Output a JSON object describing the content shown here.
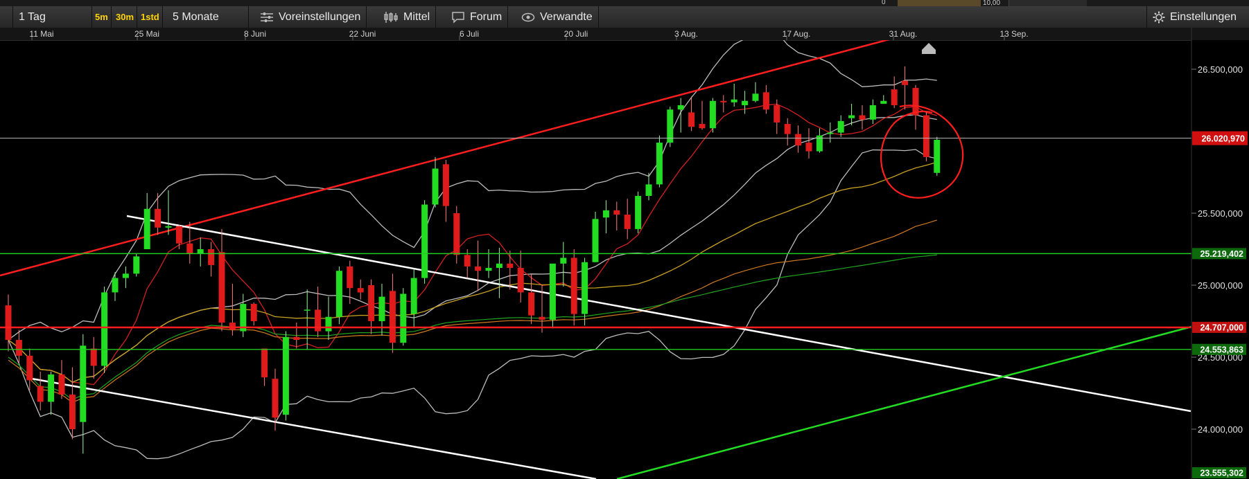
{
  "top_fragments": {
    "left_value": "0",
    "right_value": "10,00"
  },
  "toolbar": {
    "interval": "1 Tag",
    "quick_5m": "5m",
    "quick_30m": "30m",
    "quick_1std": "1std",
    "range": "5 Monate",
    "presets": "Voreinstellungen",
    "chart_style": "Mittel",
    "forum": "Forum",
    "related": "Verwandte",
    "settings": "Einstellungen"
  },
  "colors": {
    "background": "#000000",
    "bull": "#22dd22",
    "bear": "#e01b1b",
    "channel_red": "#ff1e1e",
    "channel_white": "#ffffff",
    "channel_green": "#22dd22",
    "price_label": "#d01010",
    "bollinger": "#bdbdbd"
  },
  "chart_data": {
    "type": "candlestick",
    "x_axis_labels": [
      "11 Mai",
      "25 Mai",
      "8 Juni",
      "22 Juni",
      "6 Juli",
      "20 Juli",
      "3 Aug.",
      "17 Aug.",
      "31 Aug.",
      "13 Sep."
    ],
    "y_tick_labels": [
      "26.500,000",
      "25.500,000",
      "25.000,000",
      "24.500,000",
      "24.000,000"
    ],
    "y_ticks": [
      26500,
      25500,
      25000,
      24500,
      24000
    ],
    "ylim": [
      23540,
      26760
    ],
    "current_price": {
      "value": 26020.97,
      "label": "26.020,970"
    },
    "price_levels": [
      {
        "value": 25219.402,
        "label": "25.219,402",
        "color": "green"
      },
      {
        "value": 24707.0,
        "label": "24.707,000",
        "color": "red"
      },
      {
        "value": 24553.863,
        "label": "24.553,863",
        "color": "green"
      },
      {
        "value": 23555.302,
        "label": "23.555,302",
        "color": "green"
      }
    ],
    "candles": [
      [
        1,
        24860,
        24935,
        24540,
        24620
      ],
      [
        2,
        24620,
        24690,
        24460,
        24510
      ],
      [
        3,
        24510,
        24560,
        24270,
        24340
      ],
      [
        4,
        24300,
        24400,
        24130,
        24190
      ],
      [
        5,
        24190,
        24400,
        24100,
        24380
      ],
      [
        6,
        24380,
        24480,
        24210,
        24240
      ],
      [
        7,
        24240,
        24430,
        23930,
        24000
      ],
      [
        8,
        24050,
        24660,
        23830,
        24580
      ],
      [
        9,
        24560,
        24640,
        24350,
        24440
      ],
      [
        10,
        24440,
        24990,
        24390,
        24950
      ],
      [
        11,
        24950,
        25090,
        24890,
        25050
      ],
      [
        12,
        25050,
        25130,
        24980,
        25080
      ],
      [
        13,
        25080,
        25220,
        25060,
        25200
      ],
      [
        14,
        25250,
        25640,
        25280,
        25530
      ],
      [
        15,
        25530,
        25640,
        25350,
        25400
      ],
      [
        16,
        25400,
        25660,
        25350,
        25410
      ],
      [
        17,
        25410,
        25420,
        25250,
        25290
      ],
      [
        18,
        25290,
        25440,
        25150,
        25220
      ],
      [
        19,
        25220,
        25330,
        25130,
        25250
      ],
      [
        20,
        25250,
        25300,
        25060,
        25140
      ],
      [
        21,
        25230,
        25390,
        24680,
        24740
      ],
      [
        22,
        24740,
        25010,
        24650,
        24690
      ],
      [
        23,
        24680,
        24940,
        24640,
        24870
      ],
      [
        24,
        24870,
        24880,
        24720,
        24750
      ],
      [
        25,
        24560,
        24550,
        24300,
        24360
      ],
      [
        26,
        24350,
        24420,
        23990,
        24080
      ],
      [
        27,
        24100,
        24680,
        24060,
        24640
      ],
      [
        28,
        24640,
        24740,
        24560,
        24620
      ],
      [
        29,
        24830,
        24970,
        24550,
        24830
      ],
      [
        30,
        24830,
        24990,
        24640,
        24680
      ],
      [
        31,
        24680,
        24920,
        24620,
        24780
      ],
      [
        32,
        24780,
        25130,
        24730,
        25100
      ],
      [
        33,
        25130,
        25170,
        24870,
        24980
      ],
      [
        34,
        24980,
        25040,
        24900,
        24950
      ],
      [
        35,
        25000,
        25040,
        24660,
        24750
      ],
      [
        36,
        24750,
        25010,
        24650,
        24920
      ],
      [
        37,
        24960,
        25080,
        24530,
        24600
      ],
      [
        38,
        24600,
        24980,
        24580,
        24940
      ],
      [
        39,
        24800,
        25110,
        24700,
        25050
      ],
      [
        40,
        25050,
        25590,
        25010,
        25560
      ],
      [
        41,
        25560,
        25890,
        25540,
        25810
      ],
      [
        42,
        25840,
        25870,
        25440,
        25550
      ],
      [
        43,
        25500,
        25550,
        25150,
        25210
      ],
      [
        44,
        25210,
        25250,
        25050,
        25130
      ],
      [
        45,
        25130,
        25310,
        24960,
        25100
      ],
      [
        46,
        25100,
        25250,
        25050,
        25120
      ],
      [
        47,
        25120,
        25260,
        24910,
        25150
      ],
      [
        48,
        25150,
        25240,
        24970,
        25120
      ],
      [
        49,
        25120,
        25240,
        24880,
        24950
      ],
      [
        50,
        24950,
        25080,
        24730,
        24790
      ],
      [
        51,
        24780,
        25000,
        24670,
        24760
      ],
      [
        52,
        24760,
        25080,
        24700,
        25150
      ],
      [
        53,
        25150,
        25300,
        24990,
        25190
      ],
      [
        54,
        25190,
        25250,
        24720,
        24800
      ],
      [
        55,
        24800,
        25190,
        24720,
        25160
      ],
      [
        56,
        25160,
        25510,
        25160,
        25460
      ],
      [
        57,
        25470,
        25590,
        25360,
        25520
      ],
      [
        58,
        25520,
        25580,
        25380,
        25490
      ],
      [
        59,
        25490,
        25600,
        25320,
        25390
      ],
      [
        60,
        25390,
        25650,
        25360,
        25620
      ],
      [
        61,
        25620,
        25780,
        25590,
        25700
      ],
      [
        62,
        25700,
        26040,
        25680,
        25990
      ],
      [
        63,
        25990,
        26240,
        25960,
        26220
      ],
      [
        64,
        26220,
        26300,
        26060,
        26250
      ],
      [
        65,
        26200,
        26310,
        26070,
        26100
      ],
      [
        66,
        26120,
        26280,
        26080,
        26090
      ],
      [
        67,
        26090,
        26300,
        26060,
        26280
      ],
      [
        68,
        26280,
        26320,
        26200,
        26270
      ],
      [
        69,
        26270,
        26400,
        26240,
        26290
      ],
      [
        70,
        26250,
        26350,
        26190,
        26280
      ],
      [
        71,
        26280,
        26410,
        26270,
        26330
      ],
      [
        72,
        26340,
        26390,
        26190,
        26220
      ],
      [
        73,
        26250,
        26290,
        26050,
        26130
      ],
      [
        74,
        26120,
        26160,
        25970,
        26050
      ],
      [
        75,
        26050,
        26110,
        25920,
        25970
      ],
      [
        76,
        25990,
        26090,
        25880,
        25930
      ],
      [
        77,
        25930,
        26090,
        25920,
        26040
      ],
      [
        78,
        26050,
        26130,
        25990,
        26060
      ],
      [
        79,
        26060,
        26180,
        26030,
        26140
      ],
      [
        80,
        26160,
        26260,
        26110,
        26180
      ],
      [
        81,
        26180,
        26250,
        26080,
        26150
      ],
      [
        82,
        26150,
        26290,
        26120,
        26250
      ],
      [
        83,
        26260,
        26320,
        26260,
        26280
      ],
      [
        84,
        26360,
        26450,
        26230,
        26250
      ],
      [
        85,
        26420,
        26520,
        26220,
        26390
      ],
      [
        86,
        26370,
        26390,
        26080,
        26180
      ],
      [
        87,
        26180,
        26200,
        25860,
        25890
      ],
      [
        88,
        25780,
        26030,
        25760,
        26010
      ]
    ]
  }
}
